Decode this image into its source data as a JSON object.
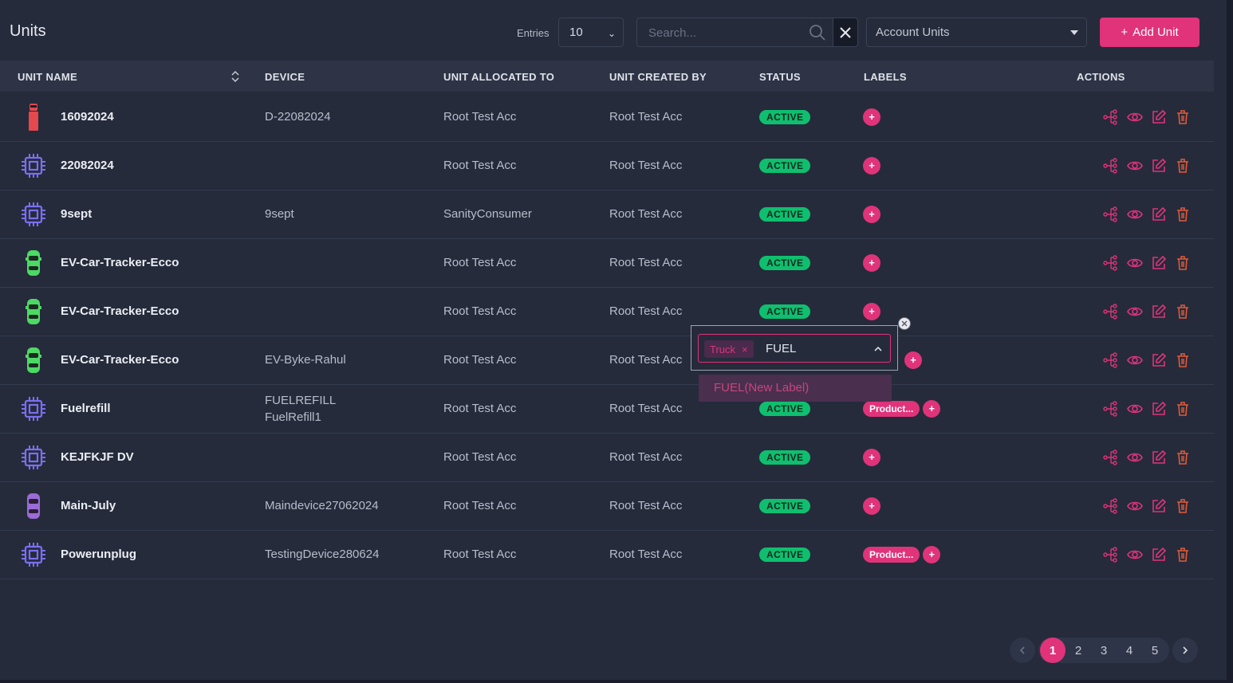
{
  "header": {
    "title": "Units",
    "entries_label": "Entries",
    "entries_value": "10",
    "search_placeholder": "Search...",
    "account_select": "Account Units",
    "add_button": "Add Unit"
  },
  "columns": [
    "UNIT NAME",
    "DEVICE",
    "UNIT ALLOCATED TO",
    "UNIT CREATED BY",
    "STATUS",
    "LABELS",
    "ACTIONS"
  ],
  "rows": [
    {
      "name": "16092024",
      "icon": "truck-icon",
      "device": "D-22082024",
      "device2": "",
      "allocated": "Root Test Acc",
      "created": "Root Test Acc",
      "status": "ACTIVE",
      "label": ""
    },
    {
      "name": "22082024",
      "icon": "chip-icon",
      "device": "",
      "device2": "",
      "allocated": "Root Test Acc",
      "created": "Root Test Acc",
      "status": "ACTIVE",
      "label": ""
    },
    {
      "name": "9sept",
      "icon": "chip-icon",
      "device": "9sept",
      "device2": "",
      "allocated": "SanityConsumer",
      "created": "Root Test Acc",
      "status": "ACTIVE",
      "label": ""
    },
    {
      "name": "EV-Car-Tracker-Ecco",
      "icon": "car-icon",
      "device": "",
      "device2": "",
      "allocated": "Root Test Acc",
      "created": "Root Test Acc",
      "status": "ACTIVE",
      "label": ""
    },
    {
      "name": "EV-Car-Tracker-Ecco",
      "icon": "car-icon",
      "device": "",
      "device2": "",
      "allocated": "Root Test Acc",
      "created": "Root Test Acc",
      "status": "ACTIVE",
      "label": ""
    },
    {
      "name": "EV-Car-Tracker-Ecco",
      "icon": "car-icon",
      "device": "EV-Byke-Rahul",
      "device2": "",
      "allocated": "Root Test Acc",
      "created": "Root Test Acc",
      "status": "",
      "label": ""
    },
    {
      "name": "Fuelrefill",
      "icon": "chip-icon",
      "device": "FUELREFILL",
      "device2": "FuelRefill1",
      "allocated": "Root Test Acc",
      "created": "Root Test Acc",
      "status": "ACTIVE",
      "label": "Product..."
    },
    {
      "name": "KEJFKJF DV",
      "icon": "chip-icon",
      "device": "",
      "device2": "",
      "allocated": "Root Test Acc",
      "created": "Root Test Acc",
      "status": "ACTIVE",
      "label": ""
    },
    {
      "name": "Main-July",
      "icon": "car-icon",
      "device": "Maindevice27062024",
      "device2": "",
      "allocated": "Root Test Acc",
      "created": "Root Test Acc",
      "status": "ACTIVE",
      "label": ""
    },
    {
      "name": "Powerunplug",
      "icon": "chip-icon",
      "device": "TestingDevice280624",
      "device2": "",
      "allocated": "Root Test Acc",
      "created": "Root Test Acc",
      "status": "ACTIVE",
      "label": "Product..."
    }
  ],
  "label_editor": {
    "tag": "Truck",
    "typed": "FUEL",
    "option": "FUEL(New Label)"
  },
  "pagination": {
    "pages": [
      "1",
      "2",
      "3",
      "4",
      "5"
    ],
    "current": "1"
  },
  "colors": {
    "accent": "#e0337a",
    "status_active": "#0fbf6f",
    "chip_icon": "#7b6ff0",
    "car_green": "#4cd964",
    "truck_red": "#e5484d",
    "car_purple": "#9b6bd6"
  }
}
